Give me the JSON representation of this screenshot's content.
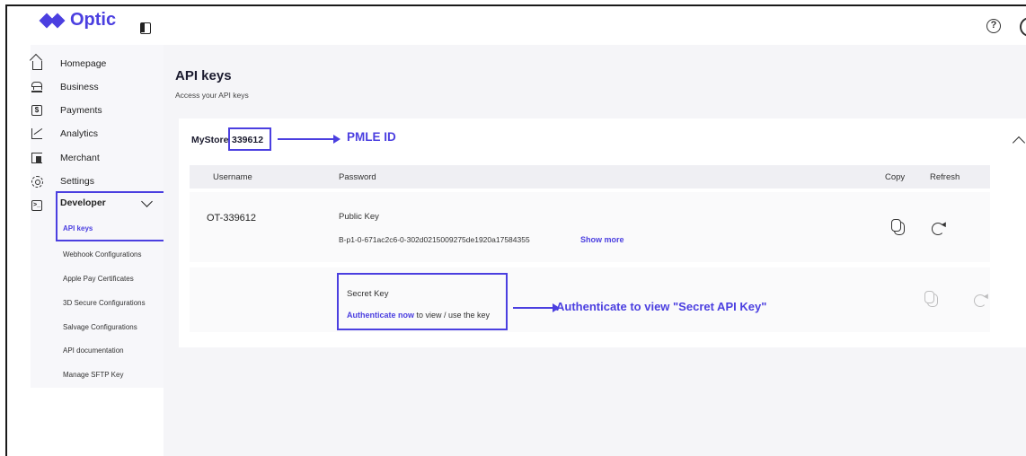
{
  "app": {
    "name": "Optic"
  },
  "sidebar": {
    "items": [
      {
        "label": "Homepage",
        "icon": "home-icon"
      },
      {
        "label": "Business",
        "icon": "bank-icon"
      },
      {
        "label": "Payments",
        "icon": "payments-icon"
      },
      {
        "label": "Analytics",
        "icon": "analytics-icon"
      },
      {
        "label": "Merchant",
        "icon": "merchant-icon"
      },
      {
        "label": "Settings",
        "icon": "gear-icon"
      },
      {
        "label": "Developer",
        "icon": "terminal-icon"
      }
    ],
    "developer_sub": [
      "API keys",
      "Webhook Configurations",
      "Apple Pay Certificates",
      "3D Secure Configurations",
      "Salvage Configurations",
      "API documentation",
      "Manage SFTP Key"
    ]
  },
  "page": {
    "title": "API keys",
    "subtitle": "Access your API keys"
  },
  "store": {
    "label": "MyStore",
    "id": "339612"
  },
  "annotations": {
    "pmle": "PMLE ID",
    "secret": "Authenticate to view \"Secret API Key\""
  },
  "table": {
    "headers": {
      "username": "Username",
      "password": "Password",
      "copy": "Copy",
      "refresh": "Refresh"
    },
    "row1": {
      "username": "OT-339612",
      "key_label": "Public Key",
      "key_value": "B-p1-0-671ac2c6-0-302d0215009275de1920a17584355",
      "show_more": "Show more"
    },
    "row2": {
      "key_label": "Secret Key",
      "auth_link": "Authenticate now",
      "auth_rest": " to view / use the key"
    }
  },
  "colors": {
    "accent": "#4b3fe0"
  }
}
